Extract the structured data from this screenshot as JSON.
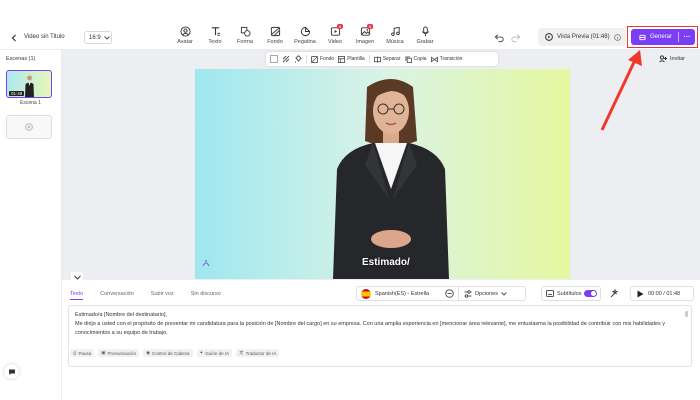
{
  "header": {
    "title": "Video sin Titulo",
    "ratio": "16:9",
    "tools": [
      {
        "label": "Avatar",
        "icon": "avatar-icon",
        "badge": ""
      },
      {
        "label": "Texto",
        "icon": "text-icon",
        "badge": ""
      },
      {
        "label": "Forma",
        "icon": "shape-icon",
        "badge": ""
      },
      {
        "label": "Fondo",
        "icon": "background-icon",
        "badge": ""
      },
      {
        "label": "Pegatina",
        "icon": "sticker-icon",
        "badge": ""
      },
      {
        "label": "Video",
        "icon": "video-icon",
        "badge": "N"
      },
      {
        "label": "Imagen",
        "icon": "image-icon",
        "badge": "N"
      },
      {
        "label": "Música",
        "icon": "music-icon",
        "badge": ""
      },
      {
        "label": "Grabar",
        "icon": "record-icon",
        "badge": ""
      }
    ],
    "preview_label": "Vista Previa (01:48)",
    "generate_label": "Generar",
    "more_label": "···"
  },
  "sidebar": {
    "scenes_title": "Escenas (1)",
    "scene_duration": "01:48",
    "scene_label": "Escena 1"
  },
  "float_bar": {
    "fondo": "Fondo",
    "plantilla": "Plantilla",
    "separar": "Separar",
    "copia": "Copia",
    "transicion": "Transición"
  },
  "invite_label": "Invitar",
  "video": {
    "caption": "Estimado/"
  },
  "panel": {
    "tabs": [
      "Texto",
      "Conversación",
      "Subir voz",
      "Sin discurso"
    ],
    "active_tab": "Texto",
    "voice": "Spanish(ES) - Estrella",
    "options": "Opciones",
    "subtitles": "Subtítulos",
    "time": "00:00 / 01:48",
    "script_line1": "Estimado/a [Nombre del destinatario],",
    "script_line2": "Me dirijo a usted con el propósito de presentar mi candidatura para la posición de [Nombre del cargo] en su empresa. Con una amplia experiencia en [mencionar área relevante], me entusiasma la posibilidad de contribuir con mis habilidades y conocimientos a su equipo de trabajo.",
    "chips": [
      "Pausa",
      "Pronunciación",
      "Control de Cabeza",
      "Guión de IA",
      "Traductor de IA"
    ]
  },
  "colors": {
    "accent": "#7a3ff2",
    "highlight": "#e53935"
  }
}
